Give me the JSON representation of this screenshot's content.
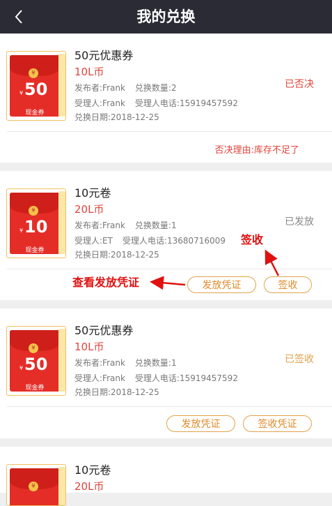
{
  "header": {
    "title": "我的兑换",
    "back_icon": "chevron-left-icon"
  },
  "colors": {
    "accent": "#e0443a",
    "button": "#e08a2a",
    "header_bg": "#2b2b35",
    "signed": "#e0a24a"
  },
  "cards": [
    {
      "name": "50元优惠券",
      "price": "10L币",
      "amount": "50",
      "coupon_label": "现金券",
      "publisher": "发布者:Frank",
      "quantity": "兑换数量:2",
      "handler": "受理人:Frank",
      "handler_phone": "受理人电话:15919457592",
      "date": "兑换日期:2018-12-25",
      "status": "已否决",
      "reason": "否决理由:库存不足了"
    },
    {
      "name": "10元卷",
      "price": "20L币",
      "amount": "10",
      "coupon_label": "现金券",
      "publisher": "发布者:Frank",
      "quantity": "兑换数量:1",
      "handler": "受理人:ET",
      "handler_phone": "受理人电话:13680716009",
      "date": "兑换日期:2018-12-25",
      "status": "已发放",
      "buttons": [
        "发放凭证",
        "签收"
      ]
    },
    {
      "name": "50元优惠券",
      "price": "10L币",
      "amount": "50",
      "coupon_label": "现金券",
      "publisher": "发布者:Frank",
      "quantity": "兑换数量:1",
      "handler": "受理人:Frank",
      "handler_phone": "受理人电话:15919457592",
      "date": "兑换日期:2018-12-25",
      "status": "已签收",
      "buttons": [
        "发放凭证",
        "签收凭证"
      ]
    },
    {
      "name": "10元卷",
      "price": "20L币"
    }
  ],
  "annotations": {
    "view_voucher": "查看发放凭证",
    "sign": "签收"
  }
}
